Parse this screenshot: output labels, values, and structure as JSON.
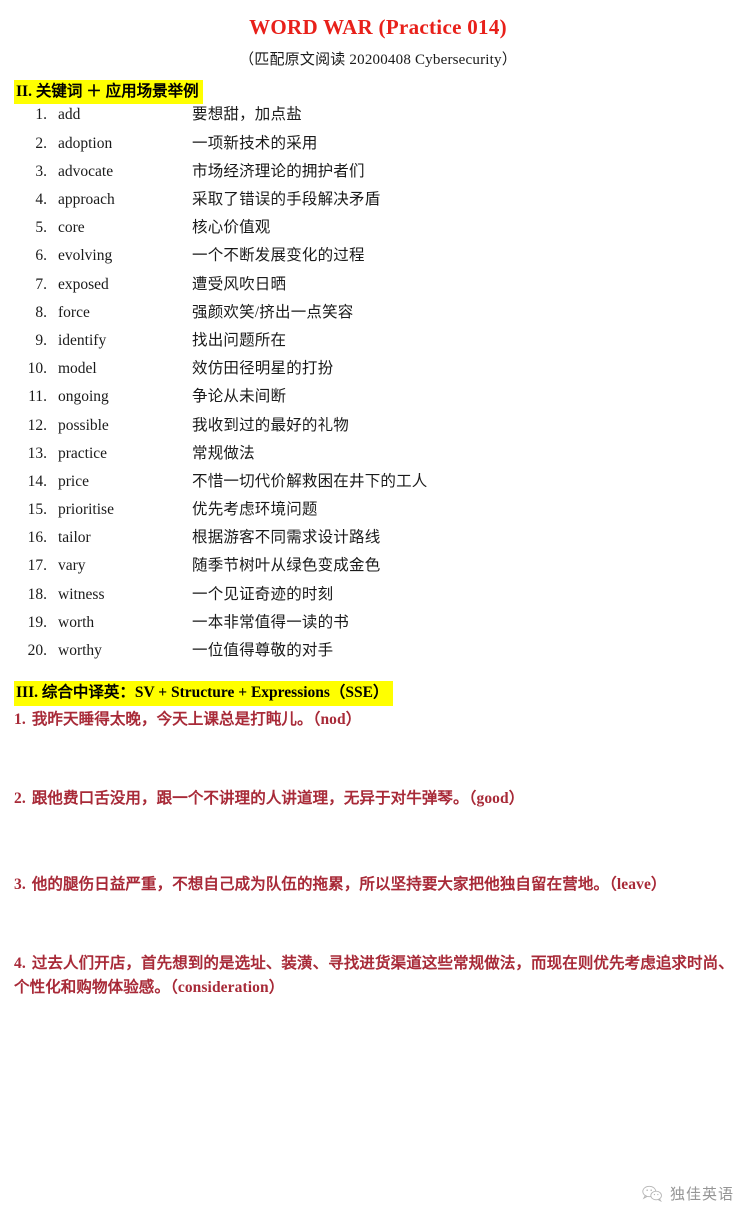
{
  "document": {
    "title": "WORD WAR (Practice 014)",
    "subtitle": "（匹配原文阅读 20200408 Cybersecurity）",
    "title_color": "#e8201a",
    "highlight_color": "#ffff00",
    "sentence_color": "#a82a38"
  },
  "section_two": {
    "heading": "II. 关键词 ＋ 应用场景举例",
    "items": [
      {
        "num": "1.",
        "word": "add",
        "example": "要想甜，加点盐"
      },
      {
        "num": "2.",
        "word": "adoption",
        "example": "一项新技术的采用"
      },
      {
        "num": "3.",
        "word": "advocate",
        "example": "市场经济理论的拥护者们"
      },
      {
        "num": "4.",
        "word": "approach",
        "example": "采取了错误的手段解决矛盾"
      },
      {
        "num": "5.",
        "word": "core",
        "example": "核心价值观"
      },
      {
        "num": "6.",
        "word": "evolving",
        "example": "一个不断发展变化的过程"
      },
      {
        "num": "7.",
        "word": "exposed",
        "example": "遭受风吹日晒"
      },
      {
        "num": "8.",
        "word": "force",
        "example": "强颜欢笑/挤出一点笑容"
      },
      {
        "num": "9.",
        "word": "identify",
        "example": "找出问题所在"
      },
      {
        "num": "10.",
        "word": "model",
        "example": "效仿田径明星的打扮"
      },
      {
        "num": "11.",
        "word": "ongoing",
        "example": "争论从未间断"
      },
      {
        "num": "12.",
        "word": "possible",
        "example": "我收到过的最好的礼物"
      },
      {
        "num": "13.",
        "word": "practice",
        "example": "常规做法"
      },
      {
        "num": "14.",
        "word": "price",
        "example": "不惜一切代价解救困在井下的工人"
      },
      {
        "num": "15.",
        "word": "prioritise",
        "example": "优先考虑环境问题"
      },
      {
        "num": "16.",
        "word": "tailor",
        "example": "根据游客不同需求设计路线"
      },
      {
        "num": "17.",
        "word": "vary",
        "example": "随季节树叶从绿色变成金色"
      },
      {
        "num": "18.",
        "word": "witness",
        "example": "一个见证奇迹的时刻"
      },
      {
        "num": "19.",
        "word": "worth",
        "example": "一本非常值得一读的书"
      },
      {
        "num": "20.",
        "word": "worthy",
        "example": "一位值得尊敬的对手"
      }
    ]
  },
  "section_three": {
    "heading": "III. 综合中译英：SV + Structure + Expressions（SSE）",
    "sentences": [
      {
        "idx": "1.",
        "text": "我昨天睡得太晚，今天上课总是打盹儿。（nod）"
      },
      {
        "idx": "2.",
        "text": "跟他费口舌没用，跟一个不讲理的人讲道理，无异于对牛弹琴。（good）"
      },
      {
        "idx": "3.",
        "text": "他的腿伤日益严重，不想自己成为队伍的拖累，所以坚持要大家把他独自留在营地。（leave）"
      },
      {
        "idx": "4.",
        "text": "过去人们开店，首先想到的是选址、装潢、寻找进货渠道这些常规做法，而现在则优先考虑追求时尚、个性化和购物体验感。（consideration）"
      }
    ]
  },
  "footer": {
    "brand": "独佳英语"
  }
}
